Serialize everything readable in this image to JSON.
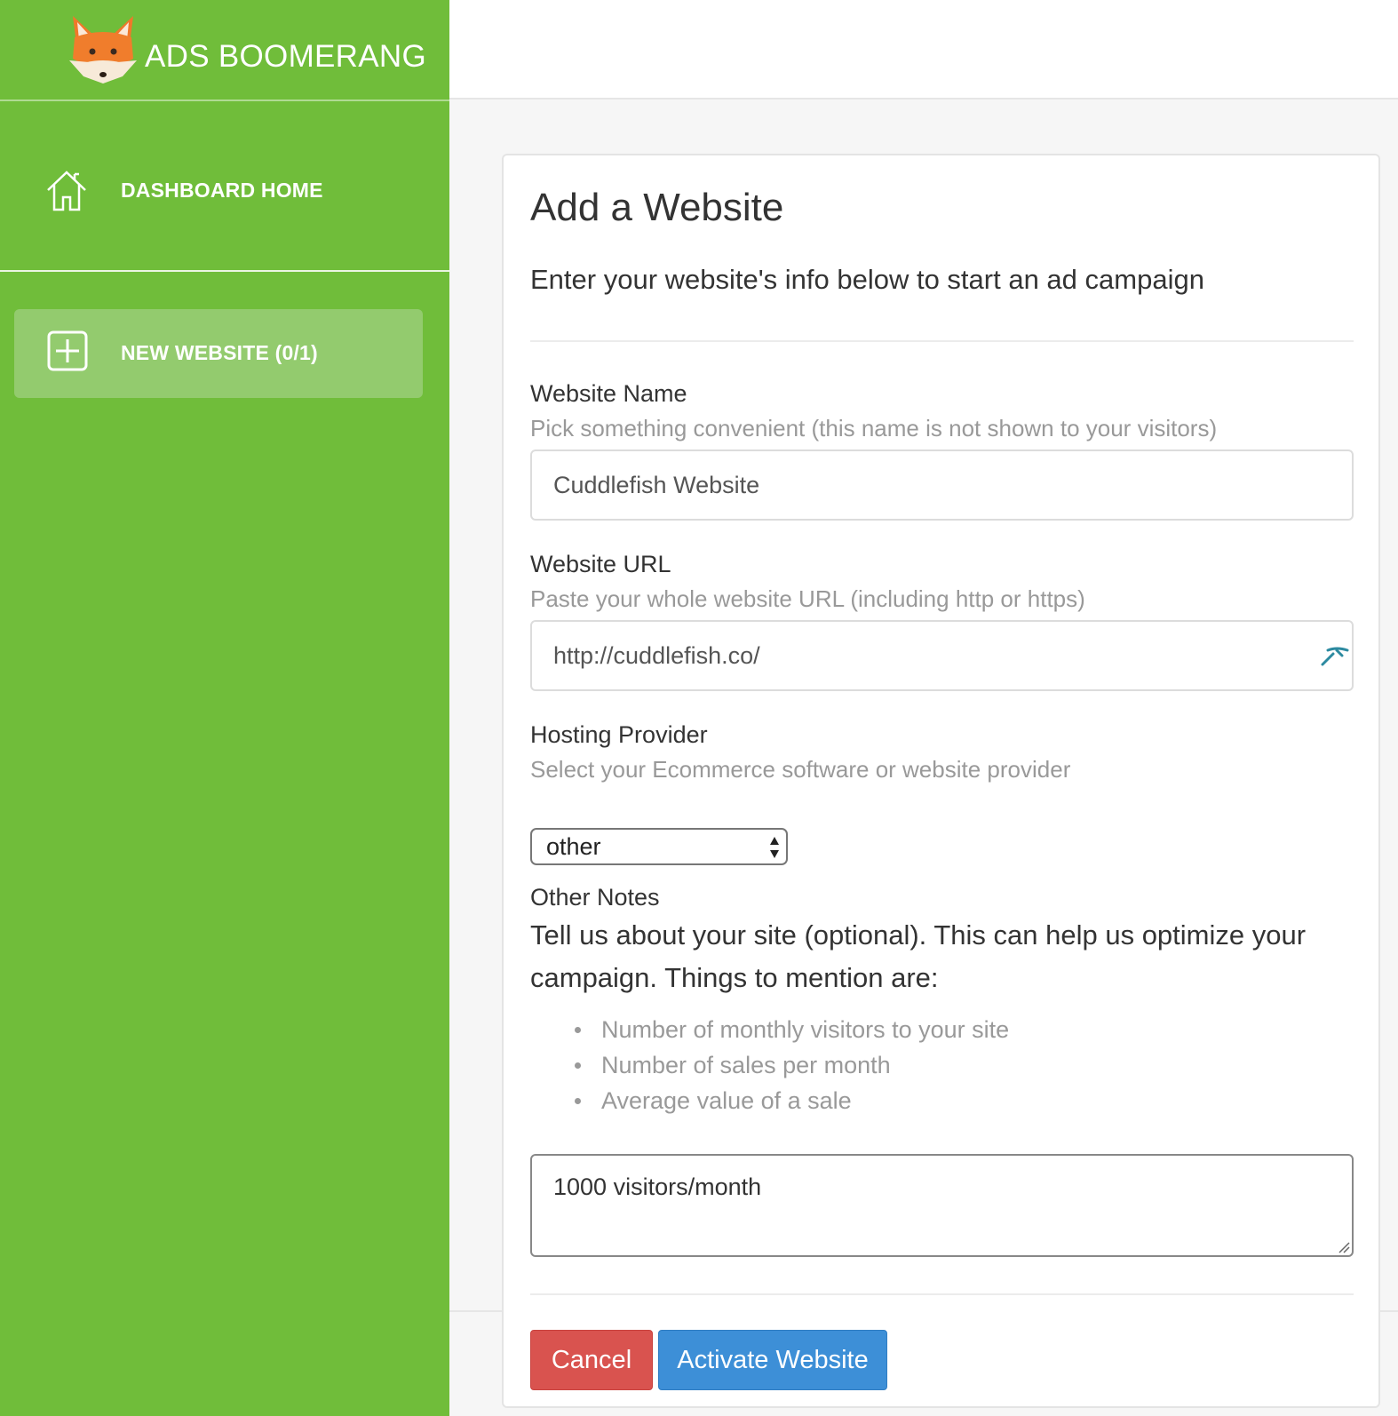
{
  "brand": {
    "name": "ADS BOOMERANG",
    "logo_icon": "fox-logo-icon"
  },
  "sidebar": {
    "items": [
      {
        "label": "DASHBOARD HOME",
        "icon": "home-icon"
      },
      {
        "label": "NEW WEBSITE (0/1)",
        "icon": "plus-square-icon",
        "active": true
      }
    ]
  },
  "form": {
    "title": "Add a Website",
    "subtitle": "Enter your website's info below to start an ad campaign",
    "website_name": {
      "label": "Website Name",
      "help": "Pick something convenient (this name is not shown to your visitors)",
      "value": "Cuddlefish Website"
    },
    "website_url": {
      "label": "Website URL",
      "help": "Paste your whole website URL (including http or https)",
      "value": "http://cuddlefish.co/",
      "icon": "extension-icon"
    },
    "hosting": {
      "label": "Hosting Provider",
      "help": "Select your Ecommerce software or website provider",
      "selected": "other"
    },
    "notes": {
      "label": "Other Notes",
      "description": "Tell us about your site (optional). This can help us optimize your campaign. Things to mention are:",
      "bullets": [
        "Number of monthly visitors to your site",
        "Number of sales per month",
        "Average value of a sale"
      ],
      "value": "1000 visitors/month"
    },
    "buttons": {
      "cancel": "Cancel",
      "activate": "Activate Website"
    }
  },
  "colors": {
    "sidebar": "#70bd3a",
    "sidebar_active": "#93cb6e",
    "cancel": "#d9534f",
    "primary": "#3d8fd7"
  }
}
